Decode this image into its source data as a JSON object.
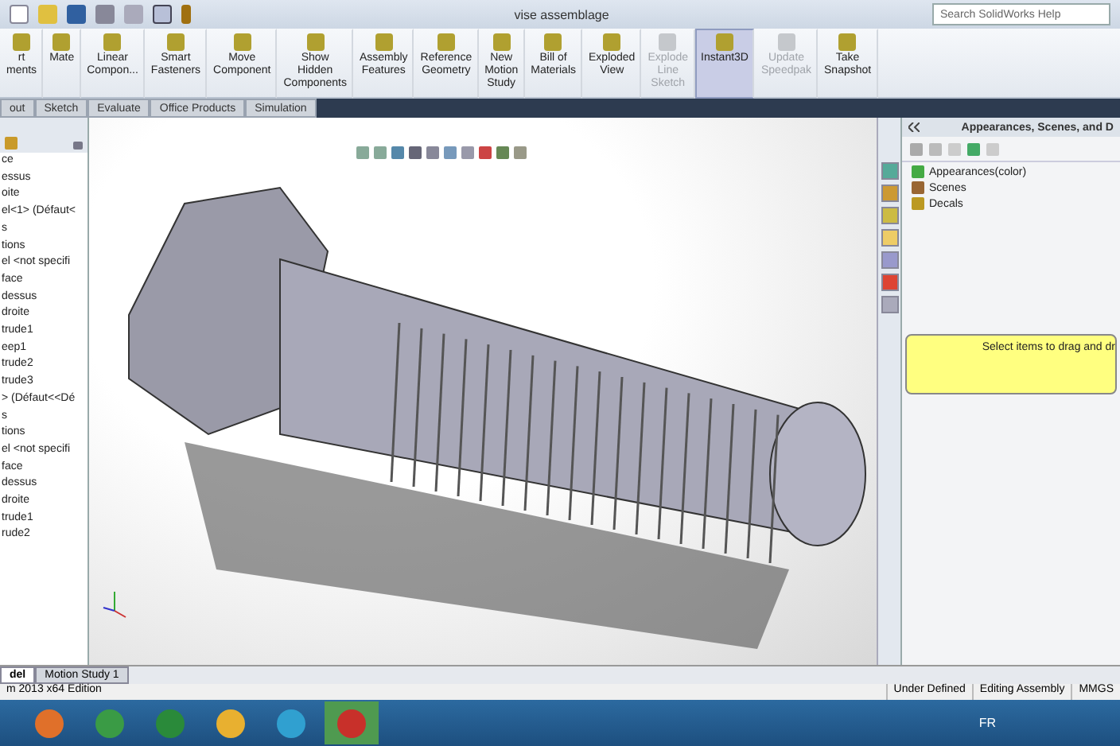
{
  "window": {
    "title": "vise assemblage"
  },
  "search": {
    "placeholder": "Search SolidWorks Help"
  },
  "ribbon": [
    {
      "label": "rt\nments",
      "disabled": false,
      "selected": false
    },
    {
      "label": "Mate",
      "disabled": false,
      "selected": false
    },
    {
      "label": "Linear\nCompon...",
      "disabled": false,
      "selected": false
    },
    {
      "label": "Smart\nFasteners",
      "disabled": false,
      "selected": false
    },
    {
      "label": "Move\nComponent",
      "disabled": false,
      "selected": false
    },
    {
      "label": "Show\nHidden\nComponents",
      "disabled": false,
      "selected": false
    },
    {
      "label": "Assembly\nFeatures",
      "disabled": false,
      "selected": false
    },
    {
      "label": "Reference\nGeometry",
      "disabled": false,
      "selected": false
    },
    {
      "label": "New\nMotion\nStudy",
      "disabled": false,
      "selected": false
    },
    {
      "label": "Bill of\nMaterials",
      "disabled": false,
      "selected": false
    },
    {
      "label": "Exploded\nView",
      "disabled": false,
      "selected": false
    },
    {
      "label": "Explode\nLine\nSketch",
      "disabled": true,
      "selected": false
    },
    {
      "label": "Instant3D",
      "disabled": false,
      "selected": true
    },
    {
      "label": "Update\nSpeedpak",
      "disabled": true,
      "selected": false
    },
    {
      "label": "Take\nSnapshot",
      "disabled": false,
      "selected": false
    }
  ],
  "tabs": [
    {
      "label": "out",
      "selected": false
    },
    {
      "label": "Sketch",
      "selected": false
    },
    {
      "label": "Evaluate",
      "selected": false
    },
    {
      "label": "Office Products",
      "selected": false
    },
    {
      "label": "Simulation",
      "selected": false
    }
  ],
  "tree": [
    "ce",
    "essus",
    "oite",
    "el<1> (Défaut<",
    "s",
    "tions",
    "el <not specifi",
    "face",
    "dessus",
    "droite",
    "trude1",
    "eep1",
    "trude2",
    "trude3",
    "> (Défaut<<Dé",
    "s",
    "tions",
    "el <not specifi",
    "face",
    "dessus",
    "droite",
    "trude1",
    "rude2"
  ],
  "task_pane": {
    "title": "Appearances, Scenes, and D",
    "items": [
      "Appearances(color)",
      "Scenes",
      "Decals"
    ],
    "hint": "Select items to drag and dr"
  },
  "bottom_tabs": [
    {
      "label": "del",
      "selected": true
    },
    {
      "label": "Motion Study 1",
      "selected": false
    }
  ],
  "status_bar": [
    "m 2013 x64 Edition",
    "Under Defined",
    "Editing Assembly",
    "MMGS"
  ],
  "taskbar": {
    "language": "FR"
  }
}
